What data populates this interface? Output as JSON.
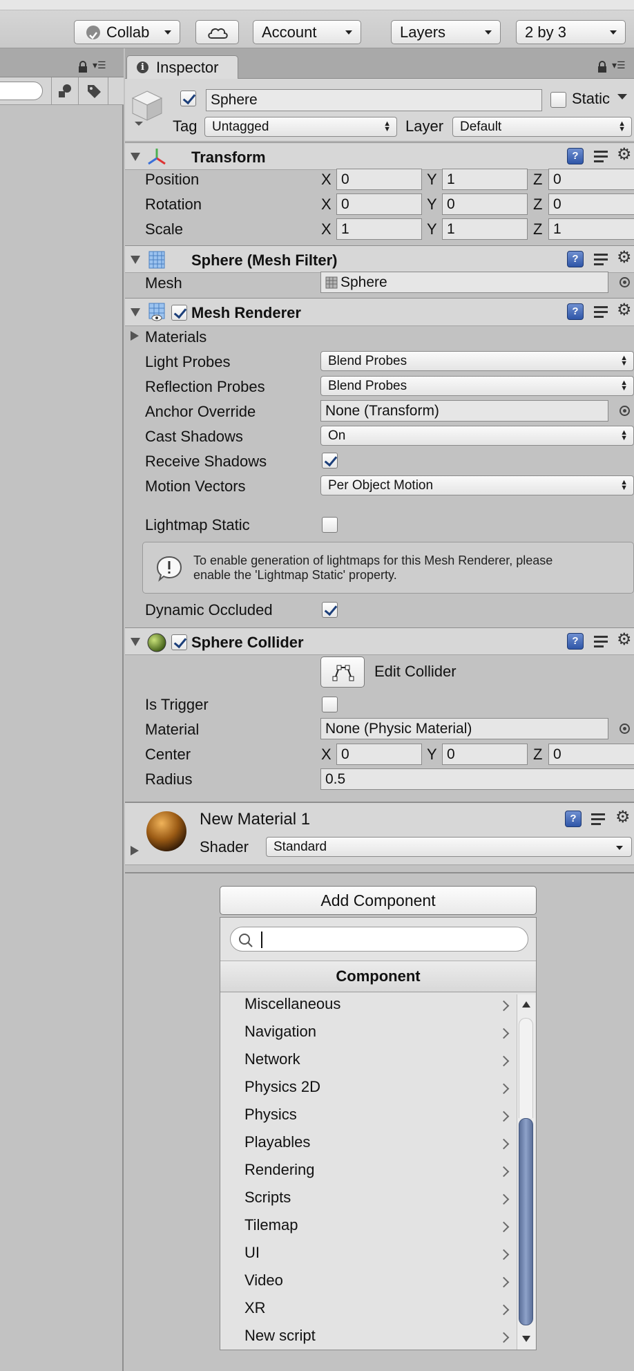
{
  "toolbar": {
    "collab": "Collab",
    "account": "Account",
    "layers": "Layers",
    "layout": "2 by 3"
  },
  "tab": {
    "label": "Inspector"
  },
  "object": {
    "name": "Sphere",
    "static_label": "Static",
    "tag_label": "Tag",
    "tag_value": "Untagged",
    "layer_label": "Layer",
    "layer_value": "Default"
  },
  "transform": {
    "title": "Transform",
    "rows": [
      {
        "label": "Position",
        "x": "0",
        "y": "1",
        "z": "0"
      },
      {
        "label": "Rotation",
        "x": "0",
        "y": "0",
        "z": "0"
      },
      {
        "label": "Scale",
        "x": "1",
        "y": "1",
        "z": "1"
      }
    ]
  },
  "axis": {
    "x": "X",
    "y": "Y",
    "z": "Z"
  },
  "mesh_filter": {
    "title": "Sphere (Mesh Filter)",
    "mesh_label": "Mesh",
    "mesh_value": "Sphere"
  },
  "mesh_renderer": {
    "title": "Mesh Renderer",
    "materials_label": "Materials",
    "light_probes_label": "Light Probes",
    "light_probes_value": "Blend Probes",
    "reflection_probes_label": "Reflection Probes",
    "reflection_probes_value": "Blend Probes",
    "anchor_override_label": "Anchor Override",
    "anchor_override_value": "None (Transform)",
    "cast_shadows_label": "Cast Shadows",
    "cast_shadows_value": "On",
    "receive_shadows_label": "Receive Shadows",
    "motion_vectors_label": "Motion Vectors",
    "motion_vectors_value": "Per Object Motion",
    "lightmap_static_label": "Lightmap Static",
    "help_text_line1": "To enable generation of lightmaps for this Mesh Renderer, please",
    "help_text_line2": "enable the 'Lightmap Static' property.",
    "dynamic_occluded_label": "Dynamic Occluded"
  },
  "sphere_collider": {
    "title": "Sphere Collider",
    "edit_collider": "Edit Collider",
    "is_trigger_label": "Is Trigger",
    "material_label": "Material",
    "material_value": "None (Physic Material)",
    "center_label": "Center",
    "center": {
      "x": "0",
      "y": "0",
      "z": "0"
    },
    "radius_label": "Radius",
    "radius_value": "0.5"
  },
  "material": {
    "name": "New Material 1",
    "shader_label": "Shader",
    "shader_value": "Standard"
  },
  "add_component": {
    "button": "Add Component",
    "search_placeholder": "",
    "header": "Component",
    "items": [
      "Miscellaneous",
      "Navigation",
      "Network",
      "Physics 2D",
      "Physics",
      "Playables",
      "Rendering",
      "Scripts",
      "Tilemap",
      "UI",
      "Video",
      "XR",
      "New script"
    ]
  },
  "colors": {
    "panel_bg": "#c2c2c2",
    "header_bg": "#d7d7d7",
    "scroll_thumb": "#6f82ab"
  }
}
